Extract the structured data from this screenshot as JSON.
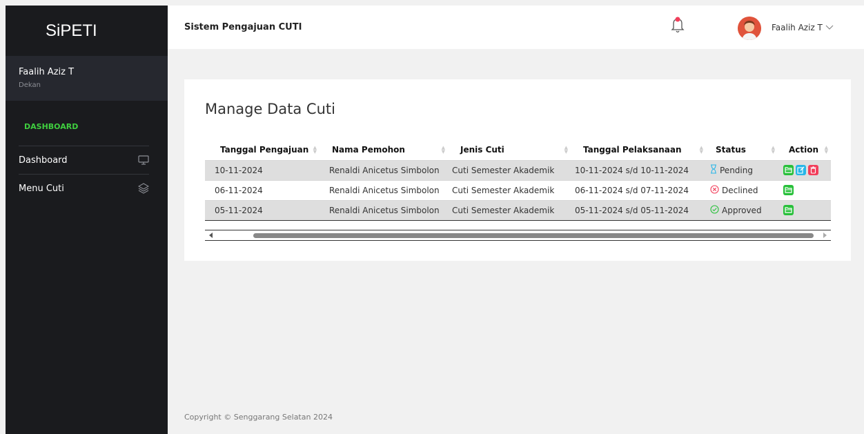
{
  "sidebar": {
    "brand": "SiPETI",
    "user_name": "Faalih Aziz T",
    "user_role": "Dekan",
    "section": "DASHBOARD",
    "items": [
      {
        "label": "Dashboard",
        "icon": "monitor-icon"
      },
      {
        "label": "Menu Cuti",
        "icon": "layers-icon"
      }
    ]
  },
  "header": {
    "title": "Sistem Pengajuan CUTI",
    "user": "Faalih Aziz T",
    "bell_icon": "bell-icon",
    "dropdown_icon": "chevron-down-icon"
  },
  "main": {
    "title": "Manage Data Cuti",
    "columns": [
      "Tanggal Pengajuan",
      "Nama Pemohon",
      "Jenis Cuti",
      "Tanggal Pelaksanaan",
      "Status",
      "Action"
    ],
    "rows": [
      {
        "tanggal_pengajuan": "10-11-2024",
        "nama": "Renaldi Anicetus Simbolon",
        "jenis": "Cuti Semester Akademik",
        "pelaksanaan": "10-11-2024 s/d 10-11-2024",
        "status": "Pending",
        "status_icon": "hourglass-icon",
        "status_color": "#29b6e8"
      },
      {
        "tanggal_pengajuan": "06-11-2024",
        "nama": "Renaldi Anicetus Simbolon",
        "jenis": "Cuti Semester Akademik",
        "pelaksanaan": "06-11-2024 s/d 07-11-2024",
        "status": "Declined",
        "status_icon": "x-circle-icon",
        "status_color": "#f23e5b"
      },
      {
        "tanggal_pengajuan": "05-11-2024",
        "nama": "Renaldi Anicetus Simbolon",
        "jenis": "Cuti Semester Akademik",
        "pelaksanaan": "05-11-2024 s/d 05-11-2024",
        "status": "Approved",
        "status_icon": "check-circle-icon",
        "status_color": "#28c03a"
      }
    ]
  },
  "footer": {
    "copyright": "Copyright © Senggarang Selatan 2024"
  },
  "colors": {
    "sidebar_bg": "#1a1b1e",
    "accent_green": "#3fcf3f",
    "btn_view": "#28c03a",
    "btn_edit": "#27b6e8",
    "btn_delete": "#f23e5b"
  }
}
